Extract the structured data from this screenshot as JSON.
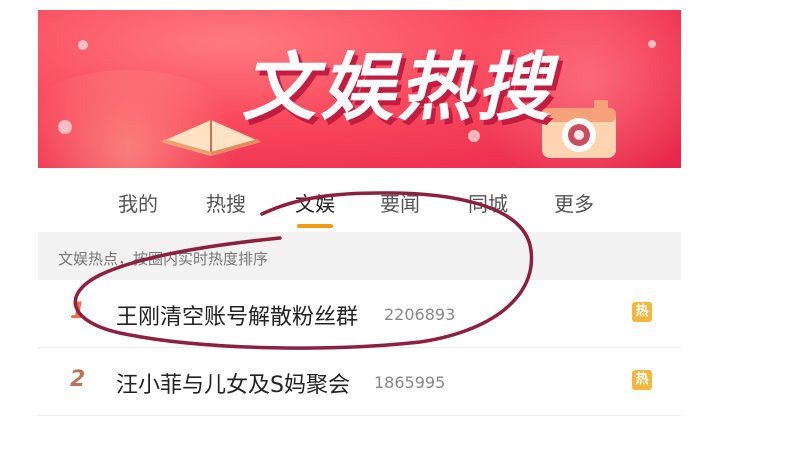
{
  "banner": {
    "title": "文娱热搜"
  },
  "tabs": [
    {
      "label": "我的"
    },
    {
      "label": "热搜"
    },
    {
      "label": "文娱"
    },
    {
      "label": "要闻"
    },
    {
      "label": "同城"
    },
    {
      "label": "更多"
    }
  ],
  "active_tab": "文娱",
  "hint": "文娱热点，按圈内实时热度排序",
  "items": [
    {
      "rank": "1",
      "title": "王刚清空账号解散粉丝群",
      "count": "2206893",
      "badge": "热"
    },
    {
      "rank": "2",
      "title": "汪小菲与儿女及S妈聚会",
      "count": "1865995",
      "badge": "热"
    }
  ],
  "colors": {
    "banner": "#f9485c",
    "accent": "#f39c12",
    "badge": "#f3b73f",
    "annotation": "#8e1f3d"
  }
}
